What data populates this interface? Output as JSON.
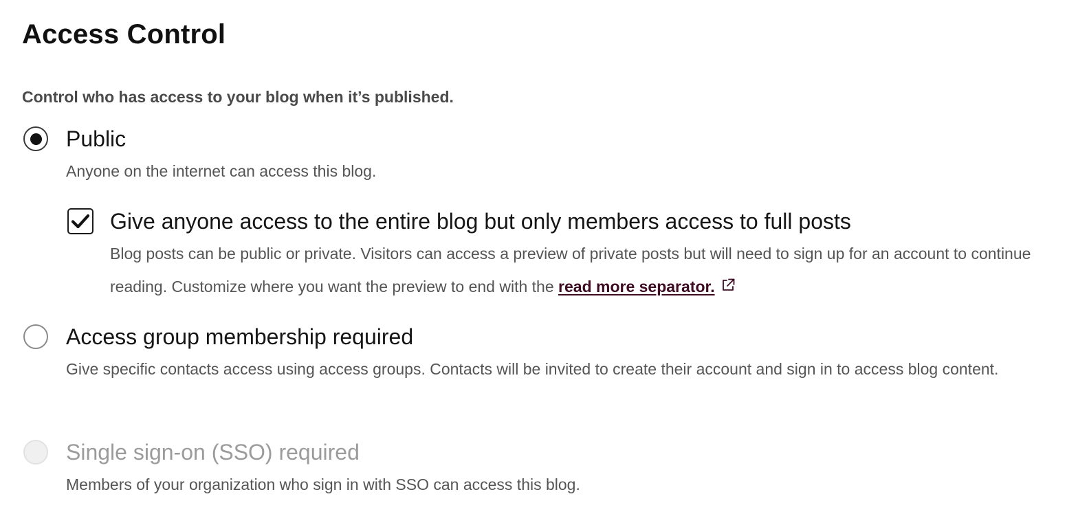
{
  "section": {
    "title": "Access Control",
    "intro": "Control who has access to your blog when it’s published."
  },
  "options": [
    {
      "label": "Public",
      "description": "Anyone on the internet can access this blog.",
      "selected": true,
      "disabled": false,
      "sub_option": {
        "label": "Give anyone access to the entire blog but only members access to full posts",
        "description_before_link": "Blog posts can be public or private. Visitors can access a preview of private posts but will need to sign up for an account to continue reading. Customize where you want the preview to end with the ",
        "link_text": "read more separator.",
        "link_icon": "external-link-icon",
        "checked": true
      }
    },
    {
      "label": "Access group membership required",
      "description": "Give specific contacts access using access groups. Contacts will be invited to create their account and sign in to access blog content.",
      "selected": false,
      "disabled": false
    },
    {
      "label": "Single sign-on (SSO) required",
      "description": "Members of your organization who sign in with SSO can access this blog.",
      "selected": false,
      "disabled": true
    }
  ],
  "colors": {
    "link": "#3e0b22",
    "disabled_text": "#9b9b9b",
    "description_text": "#555555"
  }
}
